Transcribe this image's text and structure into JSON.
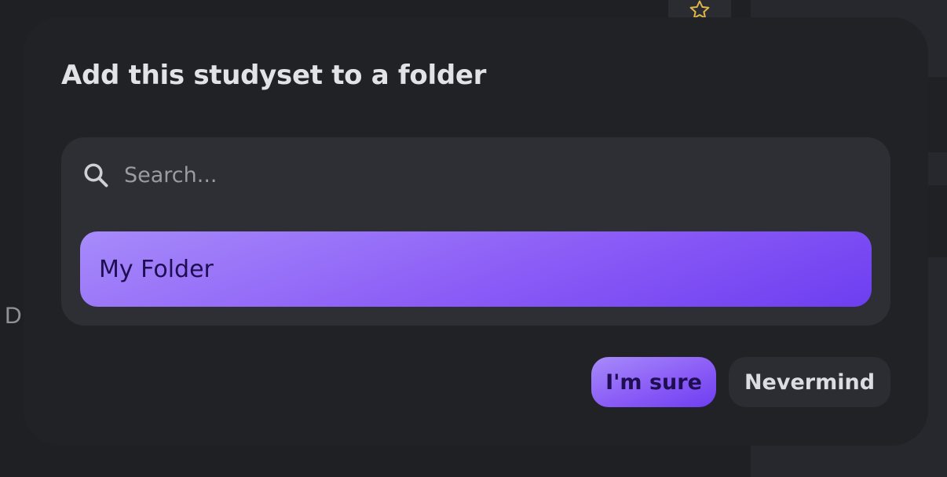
{
  "modal": {
    "title": "Add this studyset to a folder",
    "search": {
      "placeholder": "Search...",
      "value": ""
    },
    "folders": [
      {
        "label": "My Folder"
      }
    ],
    "actions": {
      "confirm_label": "I'm sure",
      "cancel_label": "Nevermind"
    }
  },
  "background": {
    "partial_letter": "D"
  },
  "colors": {
    "accent_start": "#a78bfa",
    "accent_end": "#6d3ef0",
    "accent_text": "#1e0f52",
    "modal_bg": "#202226",
    "picker_bg": "#2d2f35",
    "star": "#e0b54a"
  },
  "icons": {
    "search": "search-icon",
    "star": "star-icon"
  }
}
